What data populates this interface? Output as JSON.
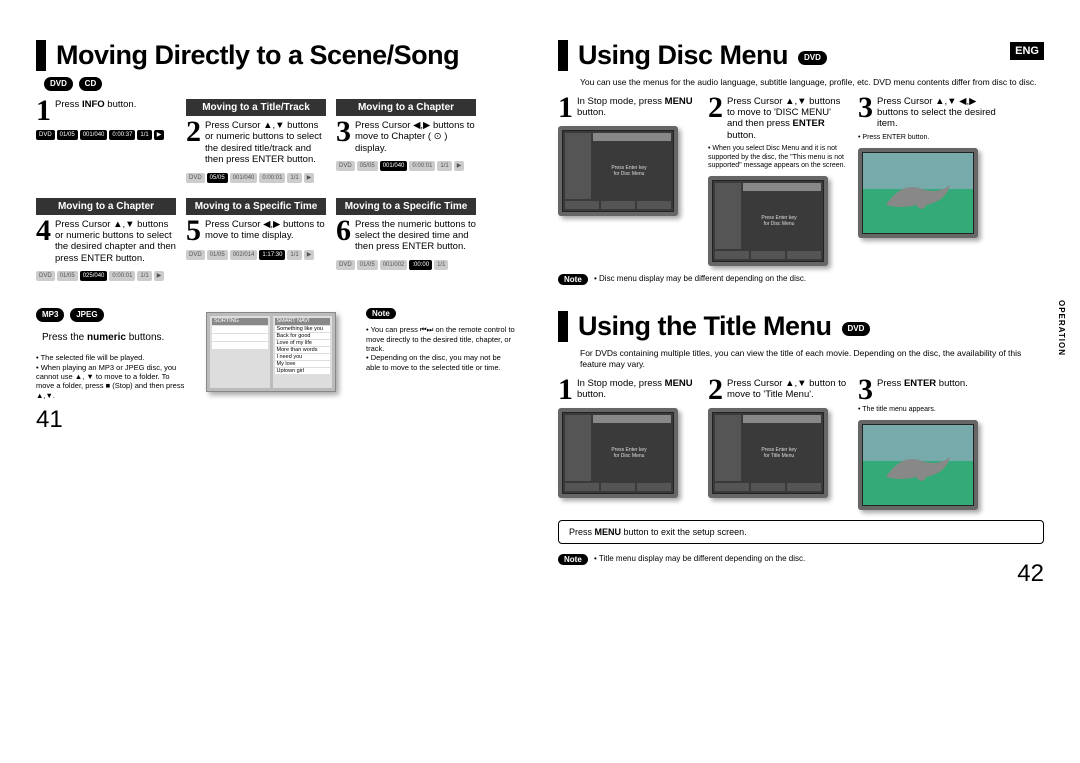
{
  "leftPage": {
    "heading": "Moving Directly to a Scene/Song",
    "badges": [
      "DVD",
      "CD"
    ],
    "steps": [
      {
        "num": "1",
        "header": "",
        "text": "Press INFO button."
      },
      {
        "num": "2",
        "header": "Moving to a Title/Track",
        "textSmall": "Press Cursor ▲,▼ buttons or numeric buttons to select the desired title/track and then press ENTER button."
      },
      {
        "num": "3",
        "header": "Moving to a Chapter",
        "text": "Press Cursor ◀,▶ buttons to move to Chapter ( ⊙ ) display."
      },
      {
        "num": "4",
        "header": "Moving to a Chapter",
        "textSmall": "Press Cursor ▲,▼ buttons or numeric buttons to select the desired chapter and then press ENTER button."
      },
      {
        "num": "5",
        "header": "Moving to a Specific Time",
        "text": "Press Cursor ◀,▶ buttons to move to time display."
      },
      {
        "num": "6",
        "header": "Moving to a Specific Time",
        "text": "Press the numeric buttons to select the desired time and then press ENTER button."
      }
    ],
    "mp3Badges": [
      "MP3",
      "JPEG"
    ],
    "mp3Text": "Press the numeric buttons.",
    "mp3Notes": [
      "The selected file will be played.",
      "When playing an MP3 or JPEG disc, you cannot use ▲, ▼ to move to a folder. To move a folder, press ■ (Stop) and then press ▲,▼."
    ],
    "rightNoteLabel": "Note",
    "rightNotes": [
      "You can press ⏮⏭ on the remote control to move directly to the desired title, chapter, or track.",
      "Depending on the disc, you may not be able to move to the selected title or time."
    ],
    "pageNum": "41",
    "playlist": {
      "sortHeader": "SORTING",
      "smartHeader": "SMART NAVI",
      "items": [
        "Something like you",
        "Back for good",
        "Love of my life",
        "More than words",
        "I need you",
        "My love",
        "Uptown girl"
      ]
    },
    "infoBarA": [
      "DVD",
      "01/05",
      "001/040",
      "0:00:37",
      "1/1",
      "▶"
    ],
    "infoBarB": [
      "DVD",
      "05/05",
      "001/040",
      "0:00:01",
      "1/1",
      "▶"
    ],
    "infoBarC": [
      "DVD",
      "05/05",
      "001/040",
      "0:00:01",
      "1/1",
      "▶"
    ],
    "infoBarD": [
      "DVD",
      "01/05",
      "025/040",
      "0:00:01",
      "1/1",
      "▶"
    ],
    "infoBarE": [
      "DVD",
      "01/05",
      "002/014",
      "1:17:30",
      "1/1",
      "▶"
    ],
    "infoBarF": [
      "DVD",
      "01/05",
      "001/002",
      "   :00:00",
      "1/1"
    ]
  },
  "rightPage": {
    "engBadge": "ENG",
    "sideTab": "OPERATION",
    "discMenu": {
      "heading": "Using Disc Menu",
      "badge": "DVD",
      "intro": "You can use the menus for the audio language, subtitle language, profile, etc. DVD menu contents differ from disc to disc.",
      "steps": [
        {
          "num": "1",
          "text": "In Stop mode, press MENU button."
        },
        {
          "num": "2",
          "text": "Press Cursor ▲,▼ buttons to move to 'DISC MENU' and then press ENTER button."
        },
        {
          "num": "3",
          "text": "Press Cursor ▲,▼ ◀,▶  buttons to select the desired item."
        }
      ],
      "subNotes2": "When you select Disc Menu and it is not supported by the disc, the \"This menu is not supported\" message appears on the screen.",
      "subNotes3": "Press ENTER button.",
      "bottomNoteLabel": "Note",
      "bottomNote": "Disc menu display may be different depending on the disc."
    },
    "titleMenu": {
      "heading": "Using the Title Menu",
      "badge": "DVD",
      "intro": "For DVDs containing multiple titles, you can view the title of each movie. Depending on the disc, the availability of this feature may vary.",
      "steps": [
        {
          "num": "1",
          "text": "In Stop mode, press MENU button."
        },
        {
          "num": "2",
          "text": "Press Cursor ▲,▼ button to move to 'Title Menu'."
        },
        {
          "num": "3",
          "text": "Press ENTER button."
        }
      ],
      "subNotes3": "The title menu appears.",
      "exitBox": "Press MENU button to exit the setup screen.",
      "bottomNoteLabel": "Note",
      "bottomNote": "Title menu display may be different depending on the disc."
    },
    "screenText": {
      "line1": "Press Enter key",
      "line2": "for Disc Menu",
      "titleLine1": "Press Enter key",
      "titleLine2": "for Title Menu"
    },
    "pageNum": "42"
  }
}
